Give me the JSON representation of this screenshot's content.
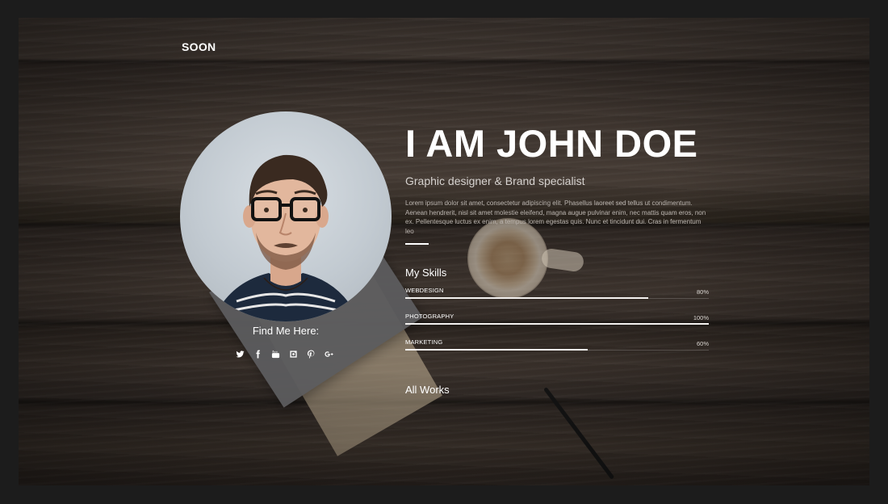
{
  "brand": {
    "logo_text": "SOON"
  },
  "profile": {
    "find_me_label": "Find Me Here:",
    "socials": [
      {
        "icon": "twitter-icon"
      },
      {
        "icon": "facebook-icon"
      },
      {
        "icon": "youtube-icon"
      },
      {
        "icon": "instagram-icon"
      },
      {
        "icon": "pinterest-icon"
      },
      {
        "icon": "google-plus-icon"
      }
    ]
  },
  "intro": {
    "headline": "I AM JOHN DOE",
    "subtitle": "Graphic designer & Brand specialist",
    "bio": "Lorem ipsum dolor sit amet, consectetur adipiscing elit. Phasellus laoreet sed tellus ut condimentum. Aenean hendrerit, nisl sit amet molestie eleifend, magna augue pulvinar enim, nec mattis quam eros, non ex. Pellentesque luctus ex enim, a tempus lorem egestas quis. Nunc et tincidunt dui. Cras in fermentum leo"
  },
  "skills": {
    "title": "My Skills",
    "items": [
      {
        "name": "WEBDESIGN",
        "percent_label": "80%",
        "level": 0.8
      },
      {
        "name": "PHOTOGRAPHY",
        "percent_label": "100%",
        "level": 1.0
      },
      {
        "name": "MARKETING",
        "percent_label": "60%",
        "level": 0.6
      }
    ]
  },
  "works": {
    "title": "All Works"
  },
  "colors": {
    "page_frame": "#1c1c1c",
    "accent_text": "#ffffff",
    "card": "#5c5c5e"
  }
}
